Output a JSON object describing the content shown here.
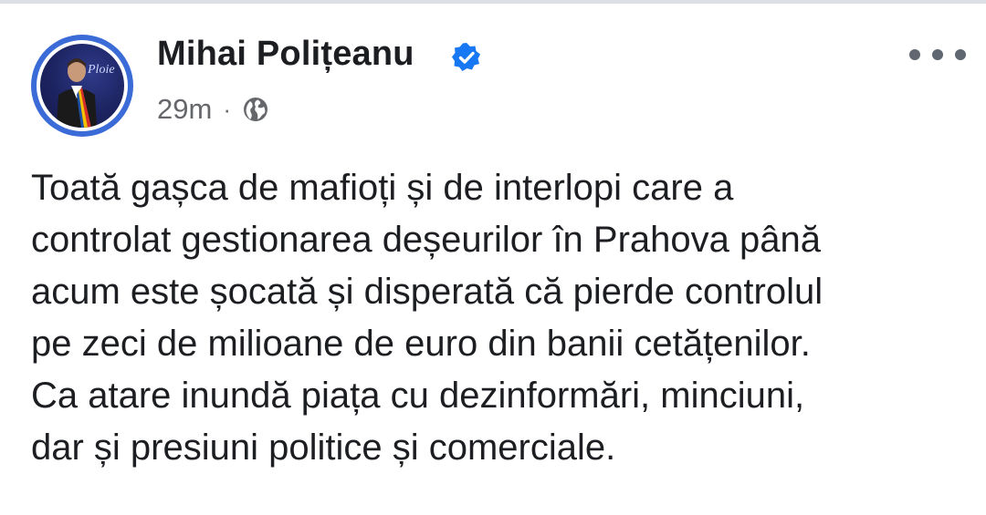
{
  "post": {
    "author": {
      "name": "Mihai Polițeanu",
      "verified": true,
      "avatar_badge_text": "Ploie"
    },
    "timestamp": "29m",
    "separator": "·",
    "audience_icon": "globe-icon",
    "more_icon": "more-options-icon",
    "text": "Toată gașca de mafioți și de interlopi care a\ncontrolat gestionarea deșeurilor în Prahova până\nacum este șocată și disperată că pierde controlul\npe zeci de milioane de euro din banii cetățenilor.\nCa atare inundă piața cu dezinformări, minciuni,\ndar și presiuni politice și comerciale."
  },
  "colors": {
    "verified_blue": "#1877f2",
    "avatar_ring": "#3b6bd6",
    "text_primary": "#1c1e21",
    "text_secondary": "#65676b"
  }
}
